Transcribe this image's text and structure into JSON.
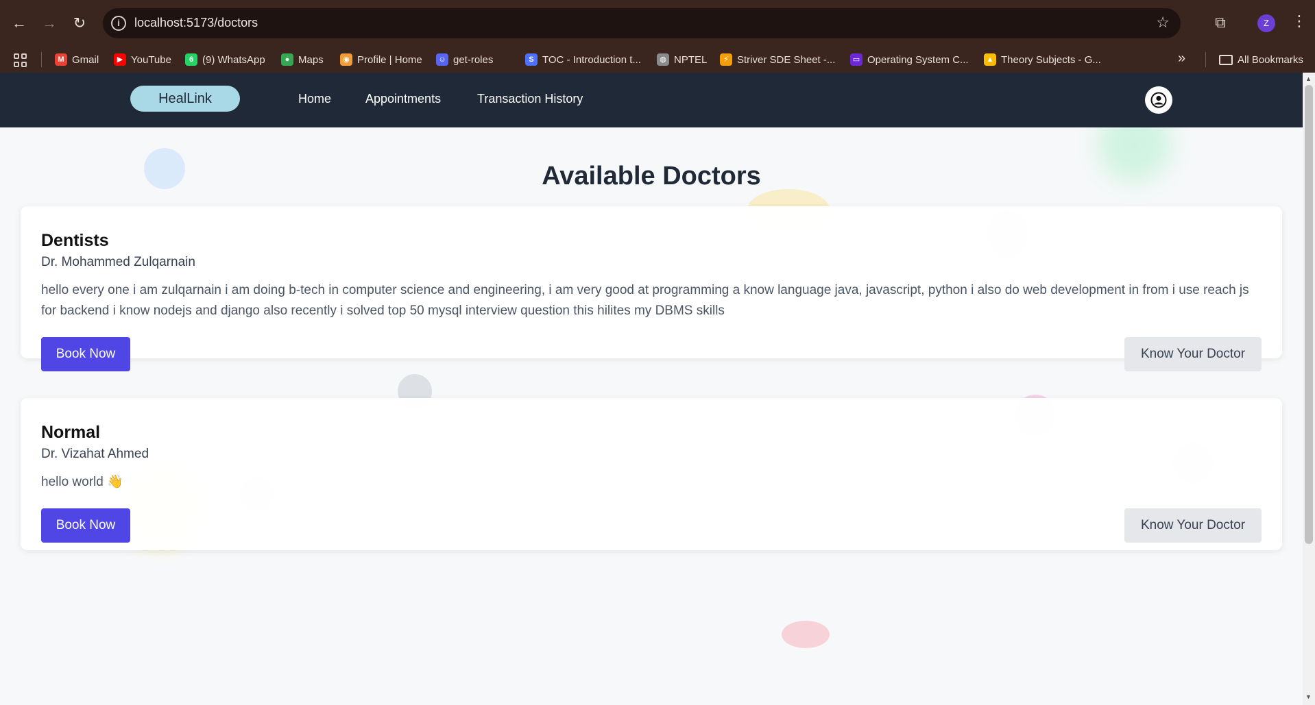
{
  "browser": {
    "url": "localhost:5173/doctors",
    "profile_initial": "Z",
    "bookmarks": [
      {
        "label": "Gmail",
        "icon": "gmail-icon",
        "color": "#ea4335",
        "glyph": "M"
      },
      {
        "label": "YouTube",
        "icon": "youtube-icon",
        "color": "#ff0000",
        "glyph": "▶"
      },
      {
        "label": "(9) WhatsApp",
        "icon": "whatsapp-icon",
        "color": "#25d366",
        "glyph": "6"
      },
      {
        "label": "Maps",
        "icon": "maps-icon",
        "color": "#34a853",
        "glyph": "●"
      },
      {
        "label": "Profile | Home",
        "icon": "profile-site-icon",
        "color": "#f29d38",
        "glyph": "◉"
      },
      {
        "label": "get-roles",
        "icon": "discord-icon",
        "color": "#5865f2",
        "glyph": "☺"
      },
      {
        "label": "TOC - Introduction t...",
        "icon": "toc-site-icon",
        "color": "#4f6fff",
        "glyph": "S"
      },
      {
        "label": "NPTEL",
        "icon": "nptel-icon",
        "color": "#8a8a8a",
        "glyph": "◍"
      },
      {
        "label": "Striver SDE Sheet -...",
        "icon": "striver-icon",
        "color": "#f59e0b",
        "glyph": "⚡"
      },
      {
        "label": "Operating System C...",
        "icon": "os-course-icon",
        "color": "#6d28d9",
        "glyph": "▭"
      },
      {
        "label": "Theory Subjects - G...",
        "icon": "drive-icon",
        "color": "#fbbc04",
        "glyph": "▲"
      }
    ],
    "all_bookmarks_label": "All Bookmarks"
  },
  "app": {
    "brand": "HealLink",
    "nav": [
      "Home",
      "Appointments",
      "Transaction History"
    ]
  },
  "page": {
    "title": "Available Doctors",
    "doctors": [
      {
        "category": "Dentists",
        "name": "Dr. Mohammed Zulqarnain",
        "description": "hello every one i am zulqarnain i am doing b-tech in computer science and engineering, i am very good at programming a know language java, javascript, python i also do web development in from i use reach js for backend i know nodejs and django also recently i solved top 50 mysql interview question this hilites my DBMS skills",
        "book_label": "Book Now",
        "know_label": "Know Your Doctor"
      },
      {
        "category": "Normal",
        "name": "Dr. Vizahat Ahmed",
        "description": "hello world 👋",
        "book_label": "Book Now",
        "know_label": "Know Your Doctor"
      }
    ]
  },
  "colors": {
    "chrome_bg": "#3a261f",
    "nav_bg": "#1f2937",
    "brand_pill": "#a9d8e6",
    "primary_button": "#4f46e5",
    "secondary_button": "#e5e7eb"
  }
}
